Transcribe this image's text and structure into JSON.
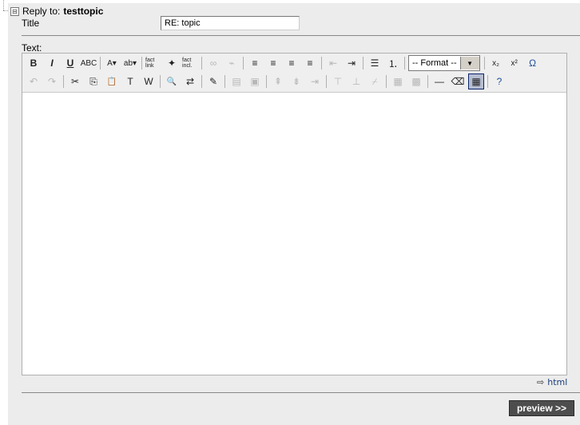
{
  "reply": {
    "prefix": "Reply to:",
    "topic": "testtopic",
    "expand_icon": "⊟"
  },
  "title": {
    "label": "Title",
    "value": "RE: topic"
  },
  "text": {
    "label": "Text:"
  },
  "toolbar": {
    "row1": [
      {
        "icon": "bold-icon",
        "glyph": "B"
      },
      {
        "icon": "italic-icon",
        "glyph": "I"
      },
      {
        "icon": "underline-icon",
        "glyph": "U"
      },
      {
        "icon": "strikethrough-icon",
        "glyph": "ABC"
      },
      {
        "sep": true
      },
      {
        "icon": "font-color-icon",
        "glyph": "A▾"
      },
      {
        "icon": "highlight-color-icon",
        "glyph": "ab▾"
      },
      {
        "sep": true
      },
      {
        "icon": "fact-link-icon",
        "glyph": "fact link"
      },
      {
        "icon": "fact-style-icon",
        "glyph": "✦"
      },
      {
        "icon": "fact-include-icon",
        "glyph": "fact incl."
      },
      {
        "sep": true
      },
      {
        "icon": "link-icon",
        "glyph": "∞",
        "disabled": true
      },
      {
        "icon": "unlink-icon",
        "glyph": "⌁",
        "disabled": true
      },
      {
        "sep": true
      },
      {
        "icon": "align-left-icon",
        "glyph": "≡"
      },
      {
        "icon": "align-center-icon",
        "glyph": "≡"
      },
      {
        "icon": "align-right-icon",
        "glyph": "≡"
      },
      {
        "icon": "align-justify-icon",
        "glyph": "≡"
      },
      {
        "sep": true
      },
      {
        "icon": "outdent-icon",
        "glyph": "⇤",
        "disabled": true
      },
      {
        "icon": "indent-icon",
        "glyph": "⇥"
      },
      {
        "sep": true
      },
      {
        "icon": "bullet-list-icon",
        "glyph": "☰"
      },
      {
        "icon": "numbered-list-icon",
        "glyph": "⒈"
      },
      {
        "sep": true
      },
      {
        "select": true
      },
      {
        "sep": true
      },
      {
        "icon": "subscript-icon",
        "glyph": "x₂"
      },
      {
        "icon": "superscript-icon",
        "glyph": "x²"
      },
      {
        "icon": "special-char-icon",
        "glyph": "Ω",
        "blue": true
      }
    ],
    "row2": [
      {
        "icon": "undo-icon",
        "glyph": "↶",
        "disabled": true
      },
      {
        "icon": "redo-icon",
        "glyph": "↷",
        "disabled": true
      },
      {
        "sep": true
      },
      {
        "icon": "cut-icon",
        "glyph": "✂"
      },
      {
        "icon": "copy-icon",
        "glyph": "⎘"
      },
      {
        "icon": "paste-icon",
        "glyph": "📋"
      },
      {
        "icon": "paste-text-icon",
        "glyph": "T"
      },
      {
        "icon": "paste-word-icon",
        "glyph": "W"
      },
      {
        "sep": true
      },
      {
        "icon": "find-icon",
        "glyph": "🔍"
      },
      {
        "icon": "replace-icon",
        "glyph": "⇄"
      },
      {
        "sep": true
      },
      {
        "icon": "edit-icon",
        "glyph": "✎"
      },
      {
        "sep": true
      },
      {
        "icon": "table-row-icon",
        "glyph": "▤",
        "disabled": true
      },
      {
        "icon": "table-props-icon",
        "glyph": "▣",
        "disabled": true
      },
      {
        "sep": true
      },
      {
        "icon": "insert-row-before-icon",
        "glyph": "⇞",
        "disabled": true
      },
      {
        "icon": "insert-row-after-icon",
        "glyph": "⇟",
        "disabled": true
      },
      {
        "icon": "delete-row-icon",
        "glyph": "⇥",
        "disabled": true
      },
      {
        "sep": true
      },
      {
        "icon": "insert-col-before-icon",
        "glyph": "⊤",
        "disabled": true
      },
      {
        "icon": "insert-col-after-icon",
        "glyph": "⊥",
        "disabled": true
      },
      {
        "icon": "delete-col-icon",
        "glyph": "⌿",
        "disabled": true
      },
      {
        "sep": true
      },
      {
        "icon": "split-cells-icon",
        "glyph": "▦",
        "disabled": true
      },
      {
        "icon": "merge-cells-icon",
        "glyph": "▩",
        "disabled": true
      },
      {
        "sep": true
      },
      {
        "icon": "horizontal-rule-icon",
        "glyph": "—"
      },
      {
        "icon": "remove-format-icon",
        "glyph": "⌫"
      },
      {
        "icon": "table-icon",
        "glyph": "▦",
        "active": true
      },
      {
        "sep": true
      },
      {
        "icon": "help-icon",
        "glyph": "?",
        "blue": true
      }
    ],
    "format_select": {
      "value": "-- Format --"
    }
  },
  "source": {
    "arrow_icon": "⇨",
    "html_label": "html"
  },
  "preview_button": {
    "label": "preview >>"
  }
}
